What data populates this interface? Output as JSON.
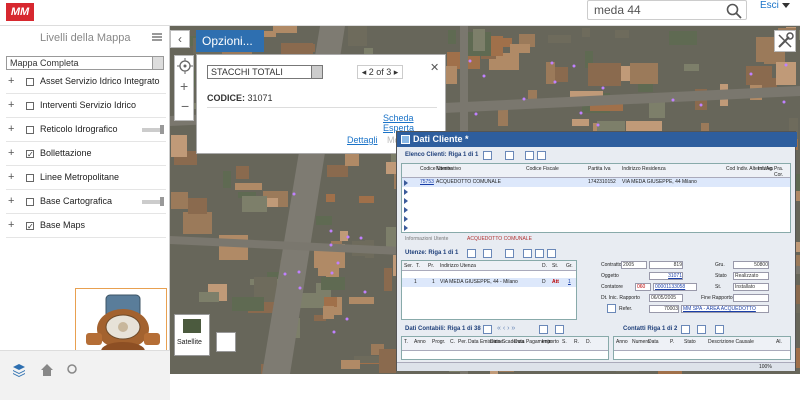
{
  "header": {
    "logo": "MM",
    "search_value": "meda 44",
    "exit_label": "Esci"
  },
  "sidebar": {
    "title": "Livelli della Mappa",
    "select_value": "Mappa Completa",
    "layers": [
      {
        "label": "Asset Servizio Idrico Integrato",
        "checked": false,
        "slider": false
      },
      {
        "label": "Interventi Servizio Idrico",
        "checked": false,
        "slider": false
      },
      {
        "label": "Reticolo Idrografico",
        "checked": false,
        "slider": true
      },
      {
        "label": "Bollettazione",
        "checked": true,
        "slider": false
      },
      {
        "label": "Linee Metropolitane",
        "checked": false,
        "slider": false
      },
      {
        "label": "Base Cartografica",
        "checked": false,
        "slider": true
      },
      {
        "label": "Base Maps",
        "checked": true,
        "slider": false
      }
    ],
    "check_mark": "✓"
  },
  "map": {
    "options_tab": "Opzioni...",
    "basemap_label": "Satellite",
    "collapse_glyph": "‹"
  },
  "popup": {
    "select_value": "STACCHI TOTALI",
    "nav_text": "2 of 3",
    "close_glyph": "✕",
    "code_label": "CODICE:",
    "code_value": "31071",
    "expert_link": "Scheda Esperta",
    "details_link": "Dettagli",
    "more_link": "Mo"
  },
  "dati_cliente": {
    "title": "Dati Cliente *",
    "elenco": {
      "header": "Elenco Clienti: Riga 1 di 1",
      "columns": [
        "Codice Utente",
        "Nominativo",
        "Codice Fiscale",
        "Partita Iva",
        "Indirizzo Residenza",
        "Cod Indiv. Alternativo",
        "Inf. Ag.",
        "Pra. Cor."
      ],
      "row": {
        "codice": "75753",
        "nominativo": "ACQUEDOTTO COMUNALE",
        "piva": "1742310152",
        "indirizzo": "VIA MEDA GIUSEPPE, 44 Milano"
      },
      "info_label": "Informazioni Utente",
      "info_value": "ACQUEDOTTO COMUNALE"
    },
    "utenze": {
      "header": "Utenze: Riga 1 di 1",
      "columns": [
        "Ser.",
        "T.",
        "Pr.",
        "Indirizzo Utenza",
        "D.",
        "St.",
        "Gr."
      ],
      "row": {
        "ser": "1",
        "pr": "1",
        "indirizzo": "VIA MEDA GIUSEPPE, 44 - Milano",
        "d": "D",
        "st": "Att",
        "gr": "1"
      }
    },
    "contratto": {
      "contratto_label": "Contratto",
      "contratto_anno": "2005",
      "contratto_num": "819",
      "gru_label": "Gru.",
      "gru_value": "50800",
      "oggetto_label": "Oggetto",
      "oggetto_value": "31071",
      "stato_label": "Stato",
      "stato_value": "Realizzato",
      "contatore_label": "Contatore",
      "contatore_a": "060",
      "contatore_b": "00001133058",
      "st_label": "St.",
      "st_value": "Installato",
      "dtinic_label": "Dt. Inic. Rapporto",
      "dtinic_value": "06/05/2005",
      "fine_label": "Fine Rapporto",
      "refer_label": "Refer.",
      "refer_num": "70003",
      "refer_name": "MM SPA - AREA ACQUEDOTTO"
    },
    "contabili": {
      "header": "Dati Contabili: Riga 1 di 38",
      "columns": [
        "T.",
        "Anno",
        "Progr.",
        "C.",
        "Per.",
        "Data Emissione",
        "Data Scadenza",
        "Data Pagamento",
        "Importo",
        "S.",
        "R.",
        "D."
      ]
    },
    "contatti": {
      "header": "Contatti Riga 1 di 2",
      "columns": [
        "Anno",
        "Numero",
        "Data",
        "P.",
        "Stato",
        "Descrizione Causale",
        "Al."
      ]
    },
    "zoom": "100%"
  },
  "colors": {
    "accent": "#2e6fb0",
    "brand": "#d7282f",
    "panel_title": "#2e5e9e"
  }
}
